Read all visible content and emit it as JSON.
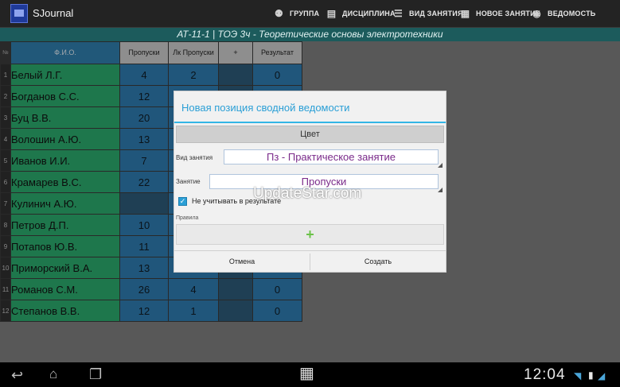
{
  "app": {
    "title": "SJournal",
    "menu": [
      {
        "icon": "group-icon",
        "label": "ГРУППА"
      },
      {
        "icon": "clipboard-icon",
        "label": "ДИСЦИПЛИНА"
      },
      {
        "icon": "list-icon",
        "label": "ВИД ЗАНЯТИЯ"
      },
      {
        "icon": "grid-icon",
        "label": "НОВОЕ ЗАНЯТИЕ"
      },
      {
        "icon": "eye-icon",
        "label": "ВЕДОМОСТЬ"
      }
    ]
  },
  "subheader": "АТ-11-1 | ТОЭ 3ч - Теоретические основы электротехники",
  "table": {
    "headers": {
      "num": "№",
      "name": "Ф.И.О.",
      "absences": "Пропуски",
      "lab_absences": "Лк Пропуски",
      "plus": "+",
      "result": "Результат"
    },
    "rows": [
      {
        "num": "1",
        "name": "Белый Л.Г.",
        "absences": "4",
        "lab": "2",
        "result": "0"
      },
      {
        "num": "2",
        "name": "Богданов С.С.",
        "absences": "12",
        "lab": "",
        "result": ""
      },
      {
        "num": "3",
        "name": "Буц В.В.",
        "absences": "20",
        "lab": "",
        "result": ""
      },
      {
        "num": "4",
        "name": "Волошин А.Ю.",
        "absences": "13",
        "lab": "",
        "result": ""
      },
      {
        "num": "5",
        "name": "Иванов И.И.",
        "absences": "7",
        "lab": "",
        "result": ""
      },
      {
        "num": "6",
        "name": "Крамарев В.С.",
        "absences": "22",
        "lab": "",
        "result": ""
      },
      {
        "num": "7",
        "name": "Кулинич А.Ю.",
        "absences": "",
        "lab": "",
        "result": ""
      },
      {
        "num": "8",
        "name": "Петров Д.П.",
        "absences": "10",
        "lab": "",
        "result": ""
      },
      {
        "num": "9",
        "name": "Потапов Ю.В.",
        "absences": "11",
        "lab": "",
        "result": ""
      },
      {
        "num": "10",
        "name": "Приморский В.А.",
        "absences": "13",
        "lab": "",
        "result": ""
      },
      {
        "num": "11",
        "name": "Романов С.М.",
        "absences": "26",
        "lab": "4",
        "result": "0"
      },
      {
        "num": "12",
        "name": "Степанов В.В.",
        "absences": "12",
        "lab": "1",
        "result": "0"
      }
    ]
  },
  "dialog": {
    "title": "Новая позиция сводной ведомости",
    "color_button": "Цвет",
    "lesson_type_label": "Вид занятия",
    "lesson_type_value": "Пз - Практическое занятие",
    "lesson_label": "Занятие",
    "lesson_value": "Пропуски",
    "ignore_result_label": "Не учитывать в результате",
    "ignore_result_checked": true,
    "rules_label": "Правила",
    "add_rule": "+",
    "cancel": "Отмена",
    "create": "Создать"
  },
  "watermark": "UpdateStar.com",
  "status": {
    "time": "12:04"
  },
  "colors": {
    "accent": "#33b5e5",
    "name_cell": "#2aa66a",
    "value_cell": "#2d78ab",
    "subheader": "#1c5b5c"
  }
}
